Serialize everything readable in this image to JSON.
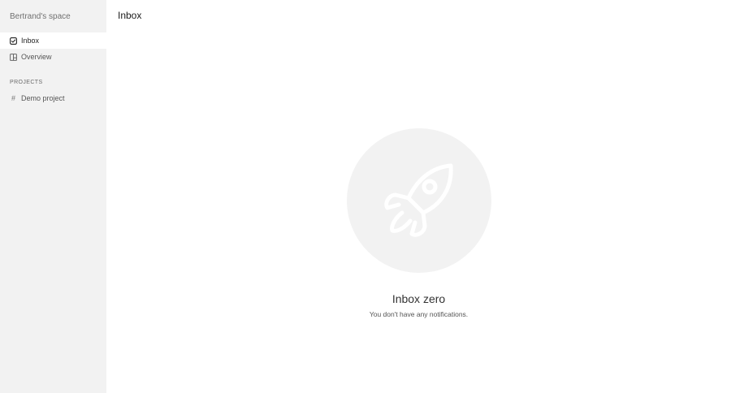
{
  "sidebar": {
    "workspace_name": "Bertrand's space",
    "nav": [
      {
        "label": "Inbox",
        "icon": "checkbox-icon",
        "active": true
      },
      {
        "label": "Overview",
        "icon": "board-icon",
        "active": false
      }
    ],
    "projects_label": "PROJECTS",
    "projects": [
      {
        "label": "Demo project",
        "icon": "hash-icon",
        "symbol": "#"
      }
    ]
  },
  "main": {
    "title": "Inbox",
    "empty_state": {
      "icon": "rocket-icon",
      "title": "Inbox zero",
      "subtitle": "You don't have any notifications."
    }
  },
  "colors": {
    "sidebar_bg": "#f2f2f2",
    "active_item_bg": "#ffffff",
    "illustration_bg": "#f2f2f2",
    "illustration_stroke": "#ffffff"
  }
}
